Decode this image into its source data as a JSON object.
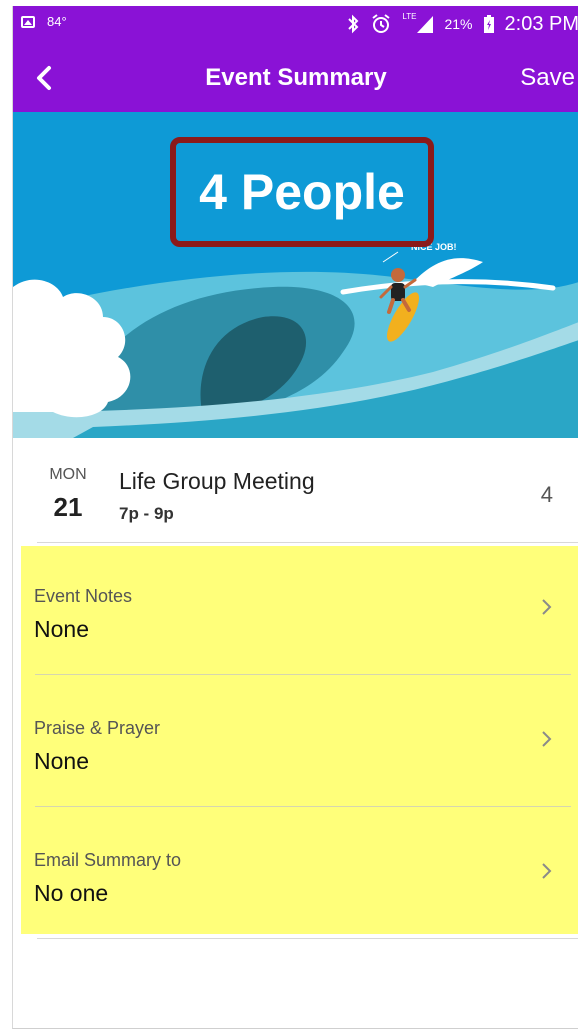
{
  "status_bar": {
    "temperature": "84°",
    "battery_percent": "21%",
    "time": "2:03 PM",
    "network": "LTE",
    "icons": [
      "image-icon",
      "bluetooth-icon",
      "alarm-icon",
      "signal-icon",
      "battery-charging-icon"
    ]
  },
  "app_bar": {
    "title": "Event Summary",
    "save_label": "Save",
    "back_icon": "back-chevron-icon"
  },
  "hero": {
    "count_label": "4 People",
    "caption": "NICE JOB!",
    "colors": {
      "sky": "#0e9ad6",
      "highlight_box": "#8b1a1a"
    }
  },
  "event": {
    "day_of_week": "MON",
    "day": "21",
    "title": "Life Group Meeting",
    "time": "7p - 9p",
    "attendee_count": "4"
  },
  "details": [
    {
      "label": "Event Notes",
      "value": "None"
    },
    {
      "label": "Praise & Prayer",
      "value": "None"
    },
    {
      "label": "Email Summary to",
      "value": "No one"
    }
  ],
  "colors": {
    "app_bar": "#8a12d6",
    "highlight": "#ffff7a"
  }
}
